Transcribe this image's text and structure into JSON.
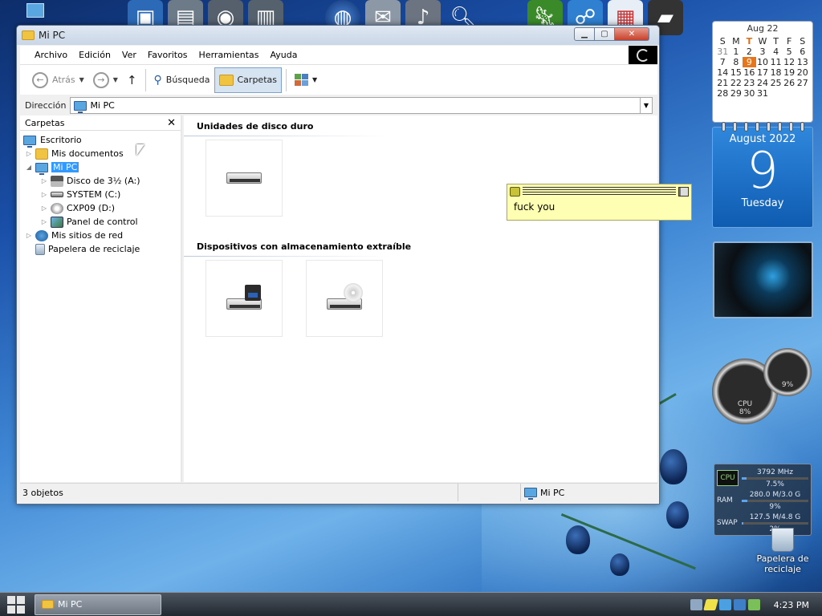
{
  "window": {
    "title": "Mi PC",
    "menu": [
      "Archivo",
      "Edición",
      "Ver",
      "Favoritos",
      "Herramientas",
      "Ayuda"
    ],
    "toolbar": {
      "back_label": "Atrás",
      "search_label": "Búsqueda",
      "folders_label": "Carpetas"
    },
    "address": {
      "label": "Dirección",
      "value": "Mi PC"
    },
    "left_pane": {
      "title": "Carpetas",
      "tree": [
        {
          "label": "Escritorio"
        },
        {
          "label": "Mis documentos"
        },
        {
          "label": "Mi PC"
        },
        {
          "label": "Disco de 3½ (A:)"
        },
        {
          "label": "SYSTEM (C:)"
        },
        {
          "label": "CXP09 (D:)"
        },
        {
          "label": "Panel de control"
        },
        {
          "label": "Mis sitios de red"
        },
        {
          "label": "Papelera de reciclaje"
        }
      ]
    },
    "groups": {
      "hard_drives": "Unidades de disco duro",
      "removable": "Dispositivos con almacenamiento extraíble"
    },
    "status": {
      "count": "3 objetos",
      "location": "Mi PC"
    }
  },
  "sticky_note": {
    "text": "fuck you"
  },
  "calendar": {
    "month_header": "Aug 22",
    "weekdays": [
      "S",
      "M",
      "T",
      "W",
      "T",
      "F",
      "S"
    ],
    "weeks": [
      [
        "31",
        "1",
        "2",
        "3",
        "4",
        "5",
        "6"
      ],
      [
        "7",
        "8",
        "9",
        "10",
        "11",
        "12",
        "13"
      ],
      [
        "14",
        "15",
        "16",
        "17",
        "18",
        "19",
        "20"
      ],
      [
        "21",
        "22",
        "23",
        "24",
        "25",
        "26",
        "27"
      ],
      [
        "28",
        "29",
        "30",
        "31",
        "",
        "",
        ""
      ]
    ],
    "today": "9"
  },
  "big_date": {
    "month_year": "August 2022",
    "day": "9",
    "weekday": "Tuesday"
  },
  "gauges": {
    "cpu_label": "CPU",
    "cpu_value": "8%",
    "mem_value": "9%"
  },
  "system_monitor": {
    "cpu": {
      "label": "CPU",
      "freq": "3792 MHz",
      "pct": "7.5%",
      "fraction": 0.075
    },
    "ram": {
      "label": "RAM",
      "usage": "280.0 M/3.0 G",
      "pct": "9%",
      "fraction": 0.09
    },
    "swap": {
      "label": "SWAP",
      "usage": "127.5 M/4.8 G",
      "pct": "2%",
      "fraction": 0.02
    }
  },
  "desktop": {
    "recycle_label": "Papelera de reciclaje"
  },
  "taskbar": {
    "task_label": "Mi PC",
    "clock": "4:23 PM"
  },
  "colors": {
    "accent": "#3399ff",
    "today": "#e5761e",
    "note_bg": "#ffffb3"
  }
}
